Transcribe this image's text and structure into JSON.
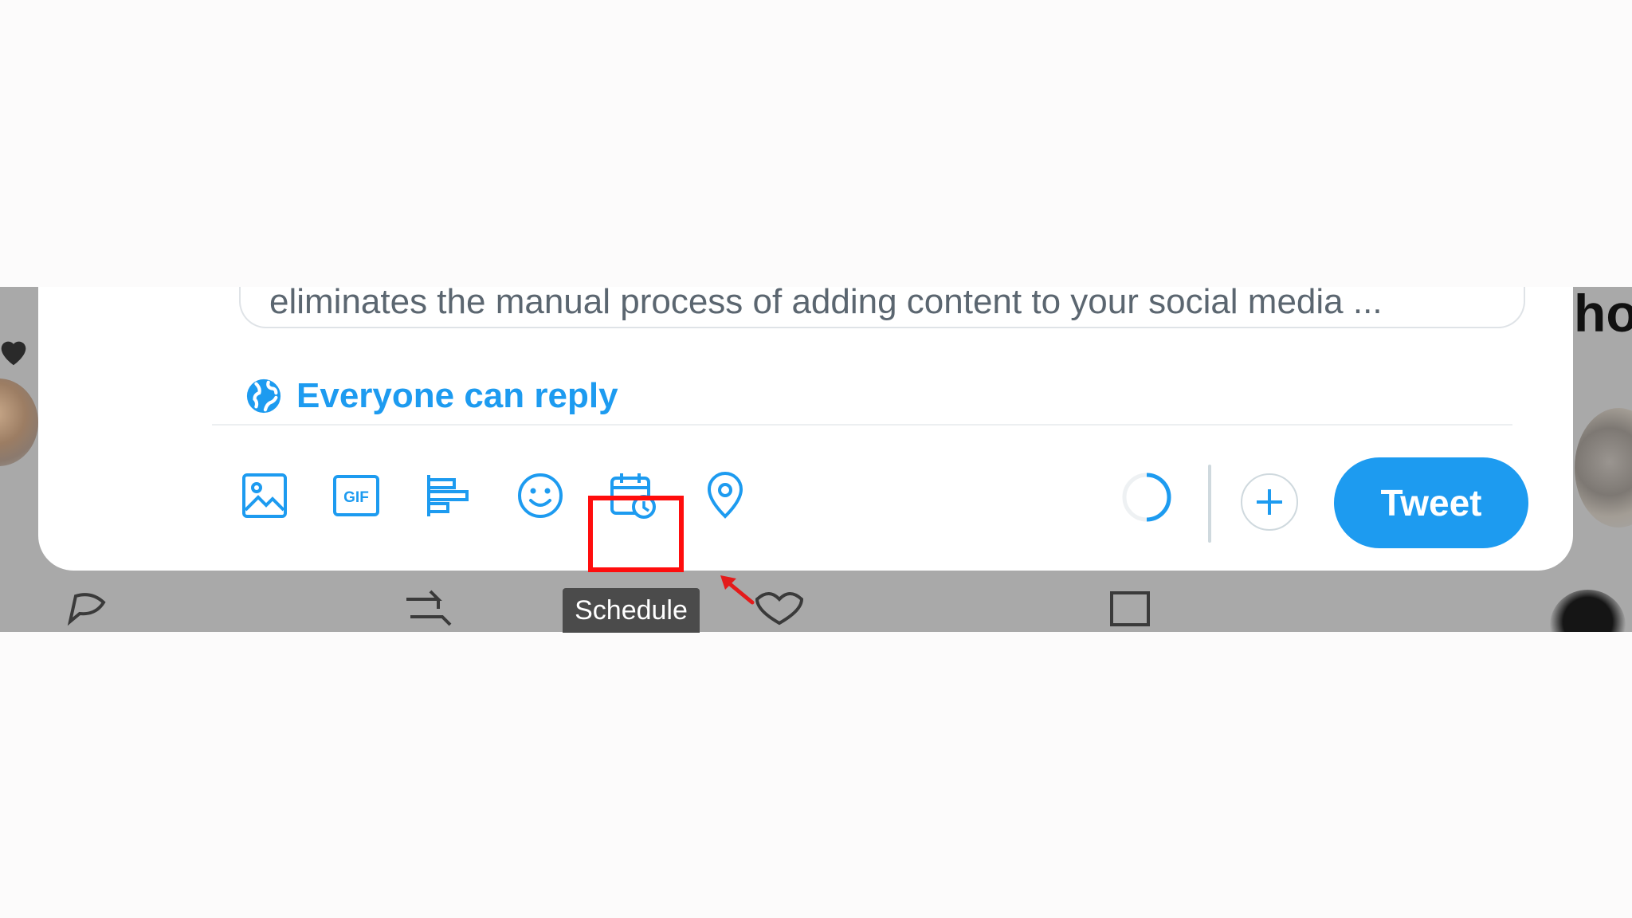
{
  "compose": {
    "preview_text": "eliminates the manual process of adding content to your social media ...",
    "reply_setting": "Everyone can reply",
    "tweet_button": "Tweet",
    "toolbar_icons": [
      "image-icon",
      "gif-icon",
      "poll-icon",
      "emoji-icon",
      "schedule-icon",
      "location-icon"
    ]
  },
  "tooltip": {
    "label": "Schedule"
  },
  "background": {
    "partial_heading": "ho"
  },
  "colors": {
    "accent": "#1d9bf0",
    "highlight": "#ff0d0d",
    "tooltip_bg": "#4b4b4b"
  }
}
